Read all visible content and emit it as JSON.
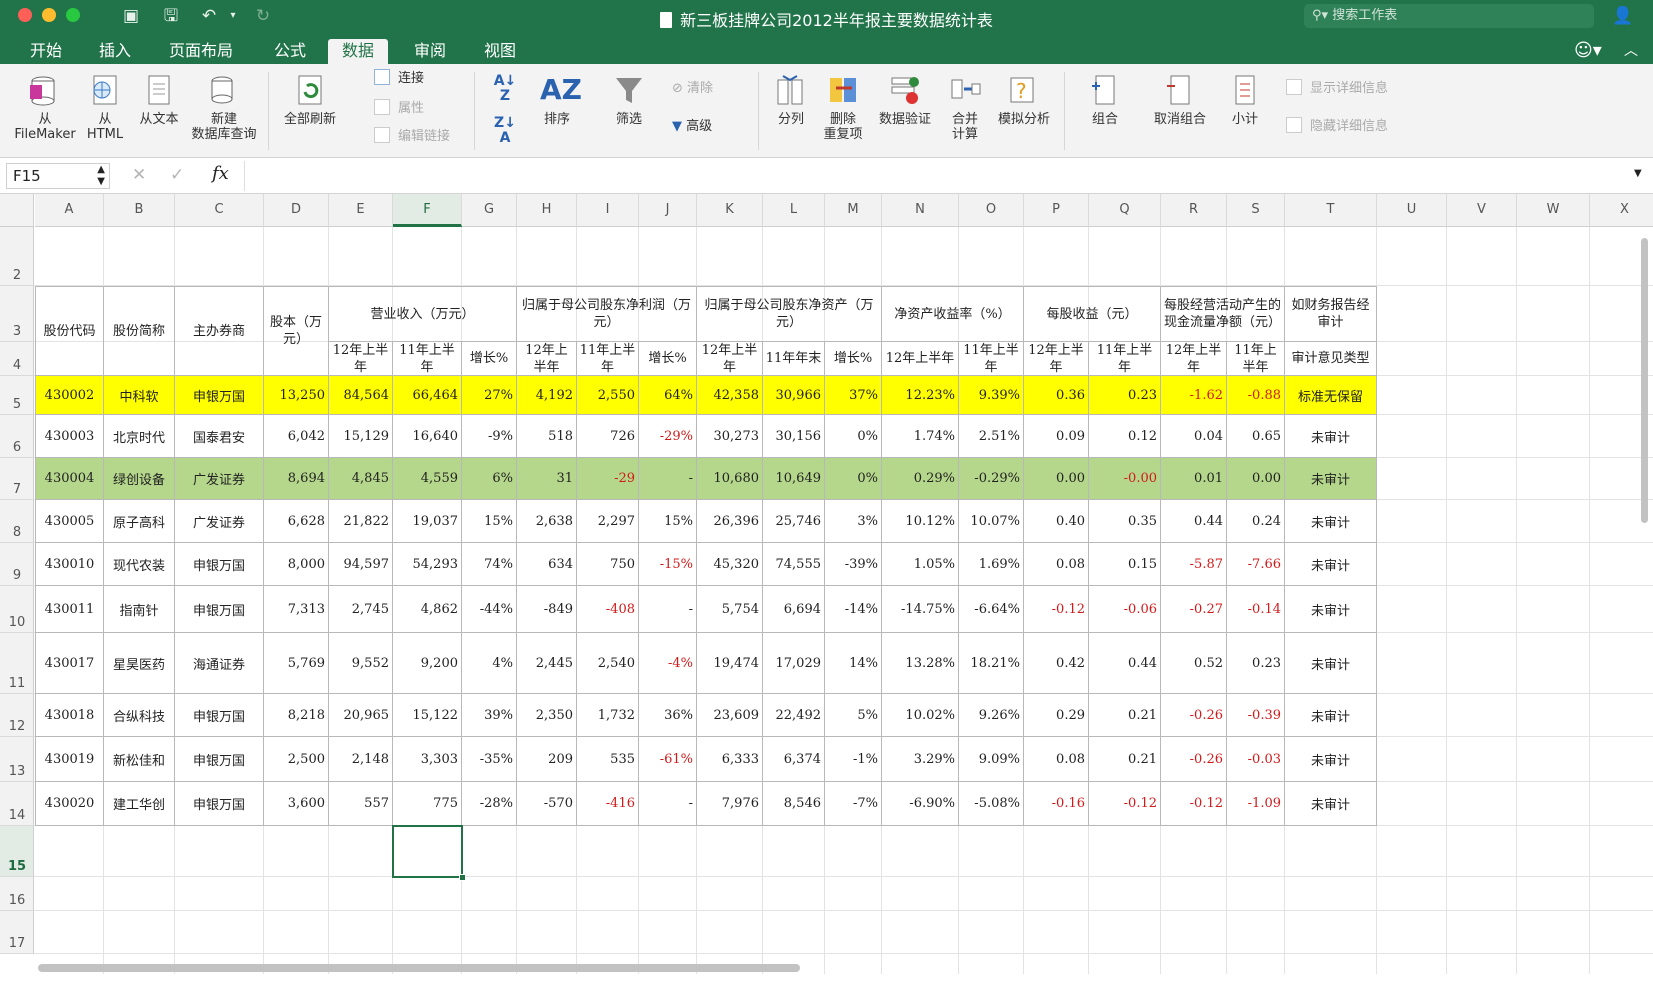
{
  "app": {
    "title": "新三板挂牌公司2012半年报主要数据统计表",
    "search_placeholder": "搜索工作表",
    "accent_color": "#217346"
  },
  "tabs": [
    "开始",
    "插入",
    "页面布局",
    "公式",
    "数据",
    "审阅",
    "视图"
  ],
  "active_tab": "数据",
  "ribbon": {
    "from_filemaker": "从\nFileMaker",
    "from_html": "从\nHTML",
    "from_text": "从文本",
    "new_db_query": "新建\n数据库查询",
    "refresh_all": "全部刷新",
    "connections": "连接",
    "properties": "属性",
    "edit_links": "编辑链接",
    "sort": "排序",
    "filter": "筛选",
    "clear": "清除",
    "advanced": "高级",
    "text_to_columns": "分列",
    "remove_duplicates": "删除\n重复项",
    "data_validation": "数据验证",
    "consolidate": "合并\n计算",
    "what_if": "模拟分析",
    "group": "组合",
    "ungroup": "取消组合",
    "subtotal": "小计",
    "show_detail": "显示详细信息",
    "hide_detail": "隐藏详细信息"
  },
  "formula_bar": {
    "name_box": "F15",
    "fx": "fx",
    "cancel_glyph": "✕",
    "enter_glyph": "✓",
    "content": ""
  },
  "columns": [
    "A",
    "B",
    "C",
    "D",
    "E",
    "F",
    "G",
    "H",
    "I",
    "J",
    "K",
    "L",
    "M",
    "N",
    "O",
    "P",
    "Q",
    "R",
    "S",
    "T",
    "U",
    "V",
    "W",
    "X"
  ],
  "selected_cell": "F15",
  "row_numbers": [
    "2",
    "3",
    "4",
    "5",
    "6",
    "7",
    "8",
    "9",
    "10",
    "11",
    "12",
    "13",
    "14",
    "15",
    "16",
    "17"
  ],
  "table": {
    "group_headers": {
      "code": "股份代码",
      "name": "股份简称",
      "broker": "主办券商",
      "capital": "股本（万元）",
      "revenue": "营业收入（万元）",
      "net_profit": "归属于母公司股东净利润（万元）",
      "net_assets": "归属于母公司股东净资产（万元）",
      "roe": "净资产收益率（%）",
      "eps": "每股收益（元）",
      "cfps": "每股经营活动产生的现金流量净额（元）",
      "audit": "如财务报告经审计"
    },
    "sub_headers": {
      "E": "12年上半年",
      "F": "11年上半年",
      "G": "增长%",
      "H": "12年上半年",
      "I": "11年上半年",
      "J": "增长%",
      "K": "12年上半年",
      "L": "11年年末",
      "M": "增长%",
      "N": "12年上半年",
      "O": "11年上半年",
      "P": "12年上半年",
      "Q": "11年上半年",
      "R": "12年上半年",
      "S": "11年上半年",
      "T": "审计意见类型"
    },
    "rows": [
      [
        "430002",
        "中科软",
        "申银万国",
        "13,250",
        "84,564",
        "66,464",
        "27%",
        "4,192",
        "2,550",
        "64%",
        "42,358",
        "30,966",
        "37%",
        "12.23%",
        "9.39%",
        "0.36",
        "0.23",
        "-1.62",
        "-0.88",
        "标准无保留"
      ],
      [
        "430003",
        "北京时代",
        "国泰君安",
        "6,042",
        "15,129",
        "16,640",
        "-9%",
        "518",
        "726",
        "-29%",
        "30,273",
        "30,156",
        "0%",
        "1.74%",
        "2.51%",
        "0.09",
        "0.12",
        "0.04",
        "0.65",
        "未审计"
      ],
      [
        "430004",
        "绿创设备",
        "广发证券",
        "8,694",
        "4,845",
        "4,559",
        "6%",
        "31",
        "-29",
        "-",
        "10,680",
        "10,649",
        "0%",
        "0.29%",
        "-0.29%",
        "0.00",
        "-0.00",
        "0.01",
        "0.00",
        "未审计"
      ],
      [
        "430005",
        "原子高科",
        "广发证券",
        "6,628",
        "21,822",
        "19,037",
        "15%",
        "2,638",
        "2,297",
        "15%",
        "26,396",
        "25,746",
        "3%",
        "10.12%",
        "10.07%",
        "0.40",
        "0.35",
        "0.44",
        "0.24",
        "未审计"
      ],
      [
        "430010",
        "现代农装",
        "申银万国",
        "8,000",
        "94,597",
        "54,293",
        "74%",
        "634",
        "750",
        "-15%",
        "45,320",
        "74,555",
        "-39%",
        "1.05%",
        "1.69%",
        "0.08",
        "0.15",
        "-5.87",
        "-7.66",
        "未审计"
      ],
      [
        "430011",
        "指南针",
        "申银万国",
        "7,313",
        "2,745",
        "4,862",
        "-44%",
        "-849",
        "-408",
        "-",
        "5,754",
        "6,694",
        "-14%",
        "-14.75%",
        "-6.64%",
        "-0.12",
        "-0.06",
        "-0.27",
        "-0.14",
        "未审计"
      ],
      [
        "430017",
        "星昊医药",
        "海通证券",
        "5,769",
        "9,552",
        "9,200",
        "4%",
        "2,445",
        "2,540",
        "-4%",
        "19,474",
        "17,029",
        "14%",
        "13.28%",
        "18.21%",
        "0.42",
        "0.44",
        "0.52",
        "0.23",
        "未审计"
      ],
      [
        "430018",
        "合纵科技",
        "申银万国",
        "8,218",
        "20,965",
        "15,122",
        "39%",
        "2,350",
        "1,732",
        "36%",
        "23,609",
        "22,492",
        "5%",
        "10.02%",
        "9.26%",
        "0.29",
        "0.21",
        "-0.26",
        "-0.39",
        "未审计"
      ],
      [
        "430019",
        "新松佳和",
        "申银万国",
        "2,500",
        "2,148",
        "3,303",
        "-35%",
        "209",
        "535",
        "-61%",
        "6,333",
        "6,374",
        "-1%",
        "3.29%",
        "9.09%",
        "0.08",
        "0.21",
        "-0.26",
        "-0.03",
        "未审计"
      ],
      [
        "430020",
        "建工华创",
        "申银万国",
        "3,600",
        "557",
        "775",
        "-28%",
        "-570",
        "-416",
        "-",
        "7,976",
        "8,546",
        "-7%",
        "-6.90%",
        "-5.08%",
        "-0.16",
        "-0.12",
        "-0.12",
        "-1.09",
        "未审计"
      ]
    ],
    "row_fills": [
      "#ffff00",
      "#ffffff",
      "#b5d78b",
      "#ffffff",
      "#ffffff",
      "#ffffff",
      "#ffffff",
      "#ffffff",
      "#ffffff",
      "#ffffff"
    ],
    "negative_color": "#d01b1b",
    "red_columns": [
      8,
      9,
      15,
      16,
      17,
      18
    ]
  }
}
